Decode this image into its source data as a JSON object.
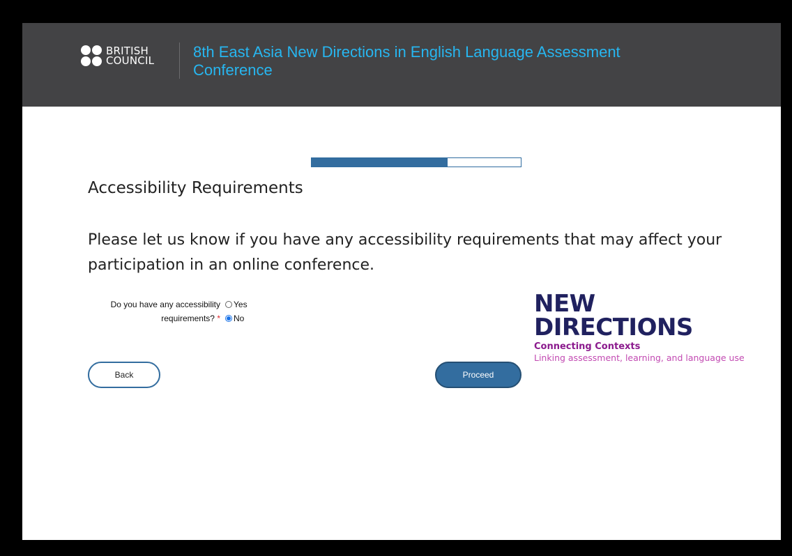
{
  "header": {
    "logo": {
      "line1": "BRITISH",
      "line2": "COUNCIL"
    },
    "conference_title": "8th East Asia New Directions in English Language Assessment Conference"
  },
  "progress": {
    "fraction": 0.65
  },
  "page": {
    "title": "Accessibility Requirements",
    "intro": "Please let us know if you have any accessibility requirements that may affect your participation in an online conference."
  },
  "question": {
    "label": "Do you have any accessibility requirements?",
    "required_marker": "*",
    "options": [
      {
        "label": "Yes",
        "selected": false
      },
      {
        "label": "No",
        "selected": true
      }
    ]
  },
  "buttons": {
    "back": "Back",
    "proceed": "Proceed"
  },
  "brand_logo": {
    "line1": "NEW",
    "line2": "DIRECTIONS",
    "tagline": "Connecting Contexts",
    "subtitle": "Linking assessment, learning, and language use"
  },
  "colors": {
    "header_bg": "#434345",
    "title_accent": "#27b6f0",
    "primary": "#336d9f",
    "brand_navy": "#20215f",
    "brand_purple": "#8b1a8d",
    "required": "#e0282d"
  }
}
